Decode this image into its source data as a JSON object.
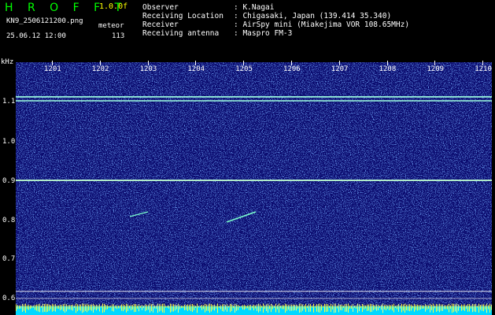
{
  "header": {
    "logo": "H R O F F T",
    "version": "1.0.0f",
    "filename": "KN9_2506121200.png",
    "mode": "meteor",
    "datetime": "25.06.12 12:00",
    "count": "113",
    "fields": [
      {
        "label": "Observer",
        "value": ": K.Nagai"
      },
      {
        "label": "Receiving Location",
        "value": ": Chigasaki, Japan (139.414 35.340)"
      },
      {
        "label": "Receiver",
        "value": ": AirSpy mini (Miakejima VOR 108.65MHz)"
      },
      {
        "label": "Receiving antenna",
        "value": ": Maspro FM-3"
      }
    ]
  },
  "axis": {
    "unit": "kHz",
    "time_ticks": [
      "1201",
      "1202",
      "1203",
      "1204",
      "1205",
      "1206",
      "1207",
      "1208",
      "1209",
      "1210"
    ],
    "freq_ticks": [
      "1.1",
      "1.0",
      "0.9",
      "0.8",
      "0.7",
      "0.6"
    ]
  },
  "colors": {
    "background": "#000000",
    "spectrum_bg": "#0a0a6e",
    "carrier": "#7cffd0",
    "logo": "#00ff00",
    "version": "#ffff00"
  }
}
